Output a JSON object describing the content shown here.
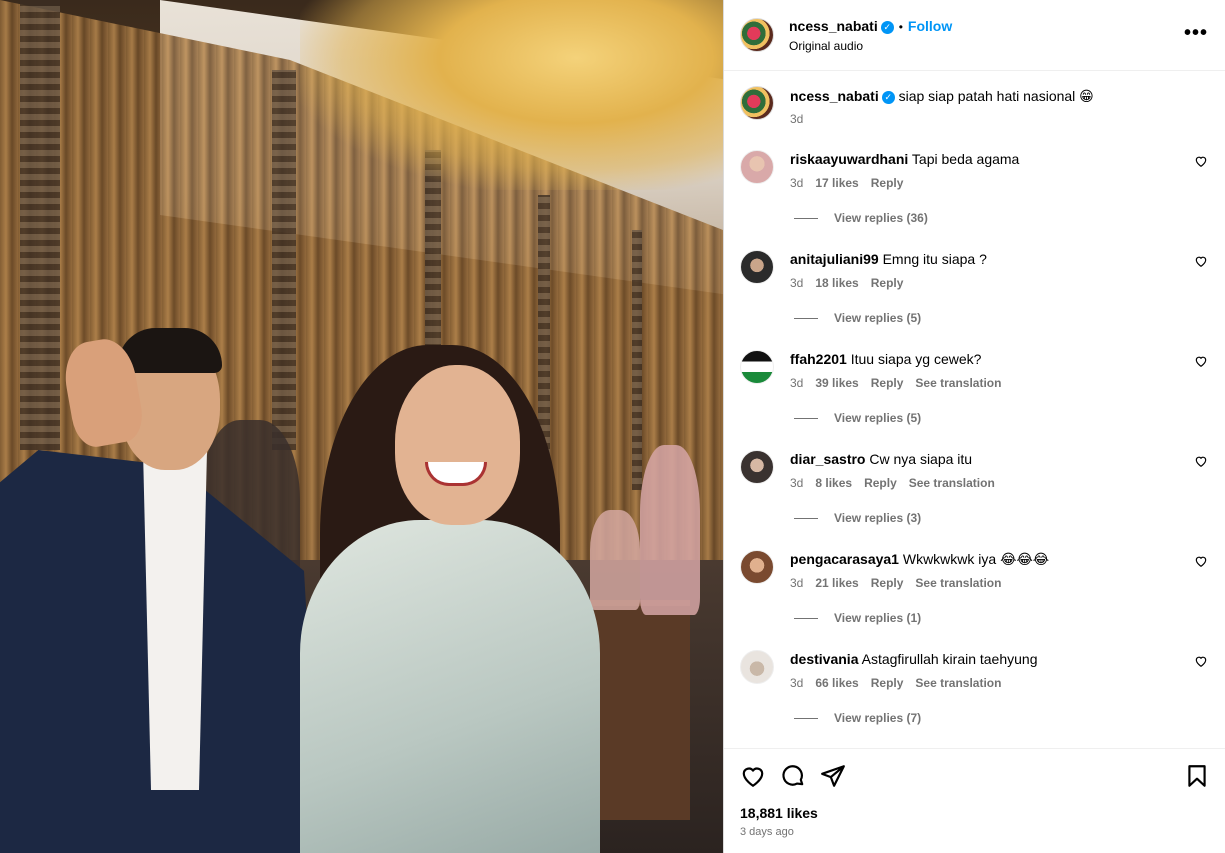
{
  "post": {
    "username": "ncess_nabati",
    "follow_label": "Follow",
    "audio": "Original audio",
    "caption": "siap siap patah hati nasional 😁",
    "caption_time": "3d",
    "likes": "18,881 likes",
    "posted_ago": "3 days ago"
  },
  "comments": [
    {
      "username": "riskaayuwardhani",
      "text": "Tapi beda agama",
      "time": "3d",
      "likes": "17 likes",
      "reply": "Reply",
      "translate": "",
      "replies": "View replies (36)"
    },
    {
      "username": "anitajuliani99",
      "text": "Emng itu siapa ?",
      "time": "3d",
      "likes": "18 likes",
      "reply": "Reply",
      "translate": "",
      "replies": "View replies (5)"
    },
    {
      "username": "ffah2201",
      "text": "Ituu siapa yg cewek?",
      "time": "3d",
      "likes": "39 likes",
      "reply": "Reply",
      "translate": "See translation",
      "replies": "View replies (5)"
    },
    {
      "username": "diar_sastro",
      "text": "Cw nya siapa itu",
      "time": "3d",
      "likes": "8 likes",
      "reply": "Reply",
      "translate": "See translation",
      "replies": "View replies (3)"
    },
    {
      "username": "pengacarasaya1",
      "text": "Wkwkwkwk iya 😂😂😂",
      "time": "3d",
      "likes": "21 likes",
      "reply": "Reply",
      "translate": "See translation",
      "replies": "View replies (1)"
    },
    {
      "username": "destivania",
      "text": "Astagfirullah kirain taehyung",
      "time": "3d",
      "likes": "66 likes",
      "reply": "Reply",
      "translate": "See translation",
      "replies": "View replies (7)"
    }
  ],
  "colors": {
    "accent": "#0095f6",
    "muted": "#737373"
  }
}
